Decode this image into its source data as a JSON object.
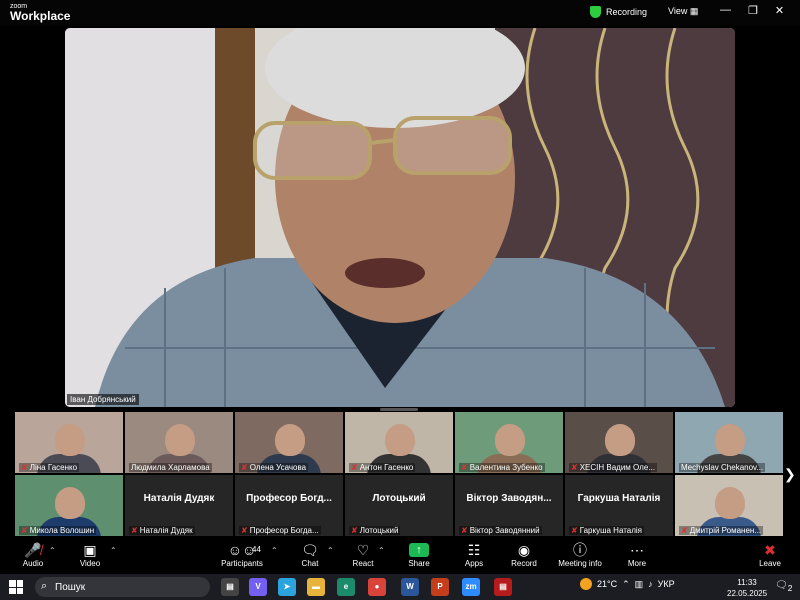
{
  "app": {
    "logo_top": "zoom",
    "logo_main": "Workplace",
    "recording": "Recording",
    "view": "View"
  },
  "main_video": {
    "speaker": "Іван Добрянський"
  },
  "participants": [
    {
      "name": "Ліна Гасенко",
      "video": true,
      "muted": true
    },
    {
      "name": "Людмила Харламова",
      "video": true,
      "muted": false
    },
    {
      "name": "Олена Усачова",
      "video": true,
      "muted": true
    },
    {
      "name": "Антон Гасенко",
      "video": true,
      "muted": true
    },
    {
      "name": "Валентина Зубенко",
      "video": true,
      "muted": true
    },
    {
      "name": "ХЕСІН Вадим Оле...",
      "video": true,
      "muted": true
    },
    {
      "name": "Mechyslav Chekanov...",
      "video": true,
      "muted": false
    },
    {
      "name": "Микола Волошин",
      "video": true,
      "muted": true
    },
    {
      "name": "Наталія Дудяк",
      "display": "Наталія Дудяк",
      "video": false,
      "muted": true
    },
    {
      "name": "Професор Богда...",
      "display": "Професор Богд...",
      "video": false,
      "muted": true
    },
    {
      "name": "Лотоцький",
      "display": "Лотоцький",
      "video": false,
      "muted": true
    },
    {
      "name": "Віктор Заводянний",
      "display": "Віктор Заводян...",
      "video": false,
      "muted": true
    },
    {
      "name": "Гаркуша Наталія",
      "display": "Гаркуша Наталія",
      "video": false,
      "muted": true
    },
    {
      "name": "Дмитрій Романен...",
      "video": true,
      "muted": true
    }
  ],
  "toolbar": {
    "audio": "Audio",
    "video": "Video",
    "participants": "Participants",
    "participants_count": "44",
    "chat": "Chat",
    "react": "React",
    "share": "Share",
    "apps": "Apps",
    "record": "Record",
    "meeting_info": "Meeting info",
    "more": "More",
    "leave": "Leave"
  },
  "taskbar": {
    "search": "Пошук",
    "weather": "21°C",
    "lang": "УКР",
    "time": "11:33",
    "date": "22.05.2025",
    "notifications": "2"
  },
  "colors": {
    "accent": "#1db954",
    "mute": "#e03030",
    "recording_shield": "#2ecc40"
  }
}
